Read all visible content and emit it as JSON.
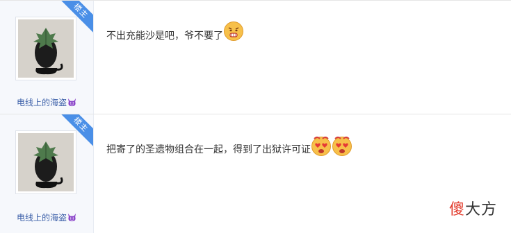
{
  "posts": [
    {
      "badge": "楼主",
      "username": "电线上的海盗",
      "text": "不出充能沙是吧，爷不要了"
    },
    {
      "badge": "楼主",
      "username": "电线上的海盗",
      "text": "把寄了的圣遗物组合在一起，得到了出狱许可证"
    }
  ],
  "watermark": {
    "part1": "傻",
    "part2": "大方"
  },
  "colors": {
    "badge": "#4a8fe7",
    "username": "#3a5ea8",
    "watermark_red": "#e23b2c"
  },
  "icons": [
    "cat-avatar",
    "devil-icon",
    "angry-face-emoji",
    "heart-eyes-emoji"
  ]
}
